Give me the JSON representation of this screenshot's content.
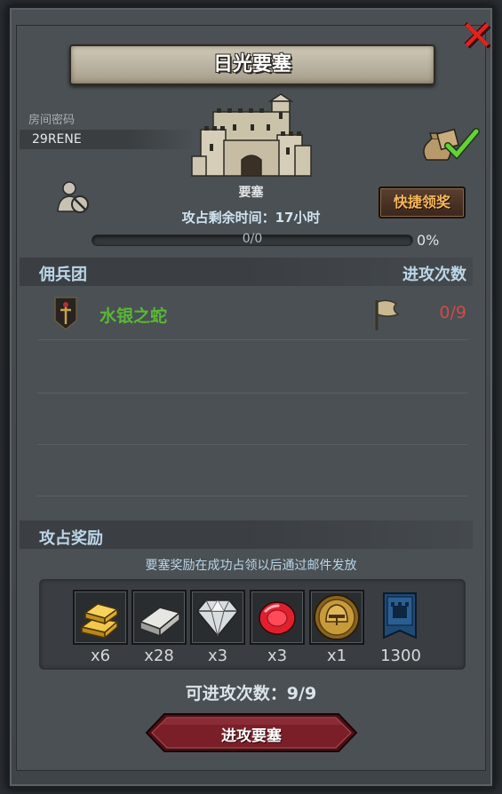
{
  "title": "日光要塞",
  "room": {
    "label": "房间密码",
    "code": "29RENE"
  },
  "fortress": {
    "name": "要塞",
    "timer_text": "攻占剩余时间：17小时"
  },
  "quick_claim_label": "快捷领奖",
  "progress": {
    "text": "0/0",
    "percent_text": "0%",
    "fraction": 0
  },
  "mercenary_section": {
    "left_header": "佣兵团",
    "right_header": "进攻次数"
  },
  "mercenaries": [
    {
      "name": "水银之蛇",
      "attacks": "0/9"
    }
  ],
  "rewards": {
    "header": "攻占奖励",
    "note": "要塞奖励在成功占领以后通过邮件发放",
    "items": [
      {
        "icon": "gold-bar-icon",
        "qty": "x6"
      },
      {
        "icon": "silver-bar-icon",
        "qty": "x28"
      },
      {
        "icon": "diamond-icon",
        "qty": "x3"
      },
      {
        "icon": "ruby-icon",
        "qty": "x3"
      },
      {
        "icon": "helmet-medal-icon",
        "qty": "x1"
      },
      {
        "icon": "guild-banner-icon",
        "qty": "1300"
      }
    ]
  },
  "attacks_remaining": "可进攻次数：9/9",
  "attack_button_label": "进攻要塞",
  "colors": {
    "merc_name": "#58b834",
    "attack_count": "#d04a4a",
    "quick_btn_text": "#f7b85a",
    "close_x": "#e0241c",
    "attack_button": "#7a1f28"
  }
}
